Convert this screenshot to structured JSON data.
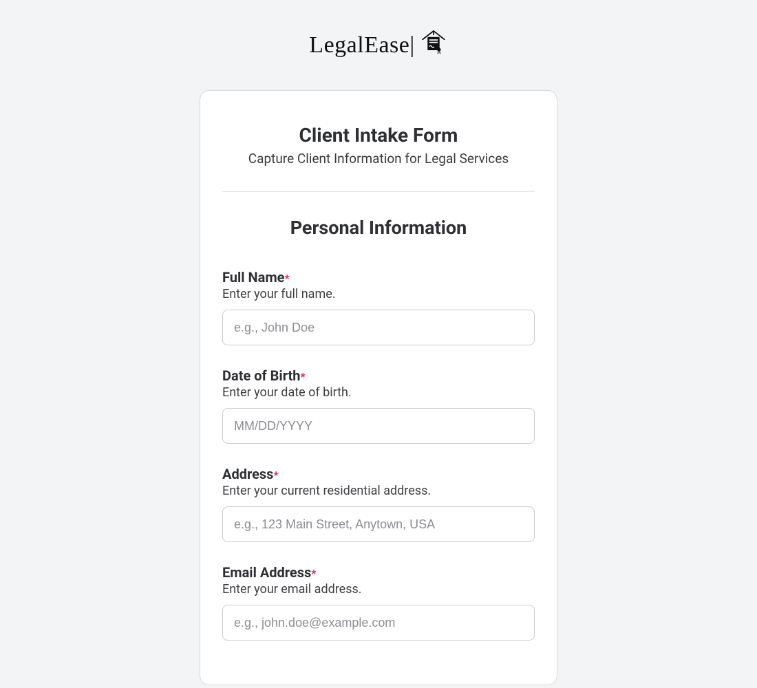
{
  "brand": {
    "name": "LegalEase|"
  },
  "form": {
    "title": "Client Intake Form",
    "subtitle": "Capture Client Information for Legal Services",
    "section_title": "Personal Information",
    "required_mark": "*",
    "fields": {
      "full_name": {
        "label": "Full Name",
        "desc": "Enter your full name.",
        "placeholder": "e.g., John Doe",
        "value": ""
      },
      "dob": {
        "label": "Date of Birth",
        "desc": "Enter your date of birth.",
        "placeholder": "MM/DD/YYYY",
        "value": ""
      },
      "address": {
        "label": "Address",
        "desc": "Enter your current residential address.",
        "placeholder": "e.g., 123 Main Street, Anytown, USA",
        "value": ""
      },
      "email": {
        "label": "Email Address",
        "desc": "Enter your email address.",
        "placeholder": "e.g., john.doe@example.com",
        "value": ""
      }
    }
  }
}
